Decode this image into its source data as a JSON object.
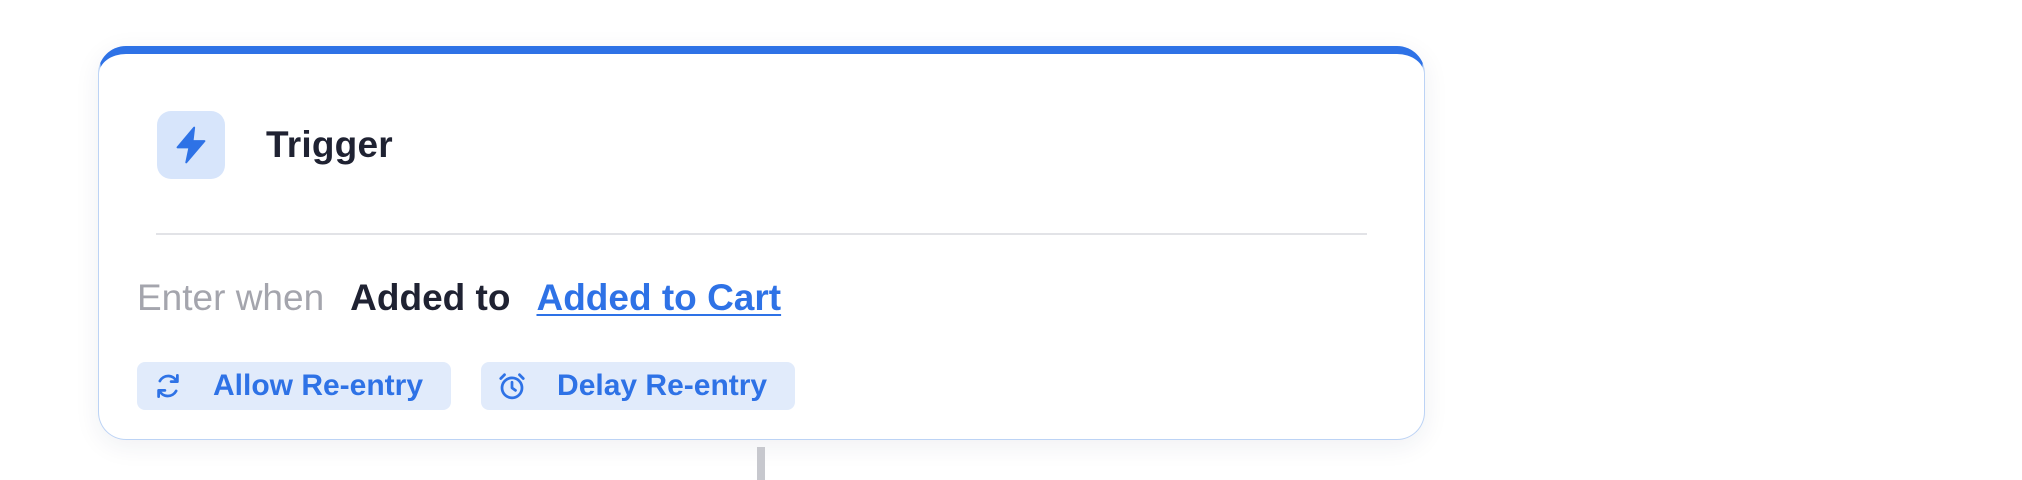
{
  "trigger_card": {
    "title": "Trigger",
    "icon": "lightning-bolt-icon",
    "condition": {
      "prefix": "Enter when",
      "event": "Added to",
      "link": "Added to Cart"
    },
    "tags": [
      {
        "label": "Allow Re-entry",
        "icon": "refresh-icon"
      },
      {
        "label": "Delay Re-entry",
        "icon": "alarm-clock-icon"
      }
    ]
  },
  "colors": {
    "accent": "#2e72e6",
    "icon_tile_bg": "#d7e5fb",
    "tag_bg": "#e1ebfb",
    "title_text": "#1f2232",
    "muted_text": "#a4a5ad"
  }
}
